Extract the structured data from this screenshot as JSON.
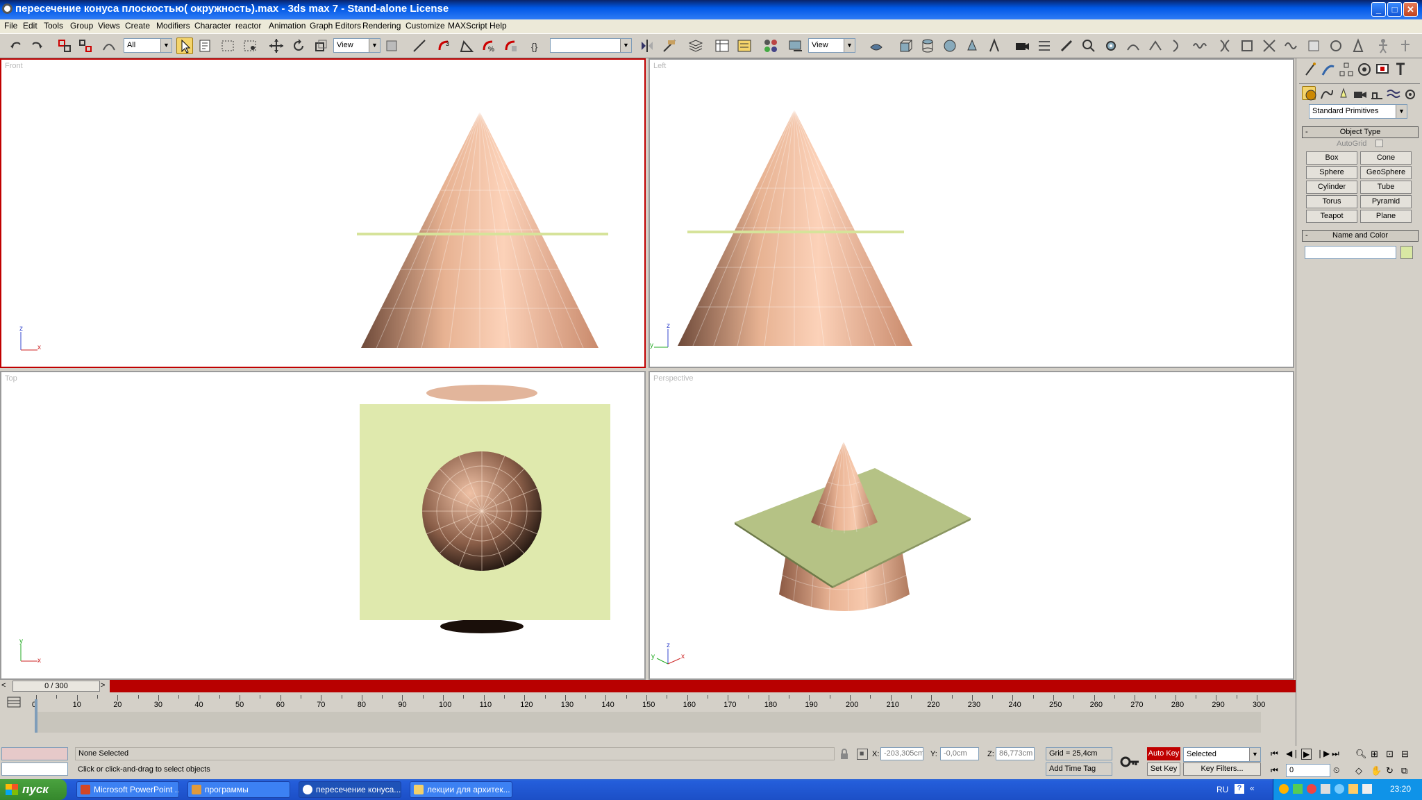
{
  "window": {
    "title": "пересечение конуса плоскостью( окружность).max - 3ds max 7  - Stand-alone License"
  },
  "menu": [
    "File",
    "Edit",
    "Tools",
    "Group",
    "Views",
    "Create",
    "Modifiers",
    "Character",
    "reactor",
    "Animation",
    "Graph Editors",
    "Rendering",
    "Customize",
    "MAXScript",
    "Help"
  ],
  "toolbar": {
    "selection_filter": "All",
    "ref_coord": "View",
    "named_sel": "",
    "render_view": "View"
  },
  "viewports": {
    "front": "Front",
    "left": "Left",
    "top": "Top",
    "perspective": "Perspective",
    "axis": {
      "x": "x",
      "y": "y",
      "z": "z"
    }
  },
  "command_panel": {
    "category": "Standard Primitives",
    "object_type_title": "Object Type",
    "autogrid": "AutoGrid",
    "buttons": [
      "Box",
      "Cone",
      "Sphere",
      "GeoSphere",
      "Cylinder",
      "Tube",
      "Torus",
      "Pyramid",
      "Teapot",
      "Plane"
    ],
    "name_color_title": "Name and Color",
    "name_value": "",
    "swatch_color": "#d9e8a3"
  },
  "timeline": {
    "frame": "0 / 300",
    "ticks": [
      "0",
      "10",
      "20",
      "30",
      "40",
      "50",
      "60",
      "70",
      "80",
      "90",
      "100",
      "110",
      "120",
      "130",
      "140",
      "150",
      "160",
      "170",
      "180",
      "190",
      "200",
      "210",
      "220",
      "230",
      "240",
      "250",
      "260",
      "270",
      "280",
      "290",
      "300"
    ]
  },
  "status": {
    "selection": "None Selected",
    "prompt": "Click or click-and-drag to select objects",
    "x_label": "X:",
    "x": "-203,305cm",
    "y_label": "Y:",
    "y": "-0,0cm",
    "z_label": "Z:",
    "z": "86,773cm",
    "grid": "Grid = 25,4cm",
    "add_time_tag": "Add Time Tag",
    "auto_key": "Auto Key",
    "set_key": "Set Key",
    "key_mode": "Selected",
    "key_filters": "Key Filters...",
    "current_frame": "0"
  },
  "taskbar": {
    "start": "пуск",
    "tasks": [
      "Microsoft PowerPoint ...",
      "программы",
      "пересечение конуса...",
      "лекции для архитек..."
    ],
    "lang": "RU",
    "clock": "23:20"
  },
  "colors": {
    "accent_red": "#c00000",
    "cone": "#e8a98a",
    "plane": "#dfe9ad",
    "title_blue": "#0058e6"
  }
}
